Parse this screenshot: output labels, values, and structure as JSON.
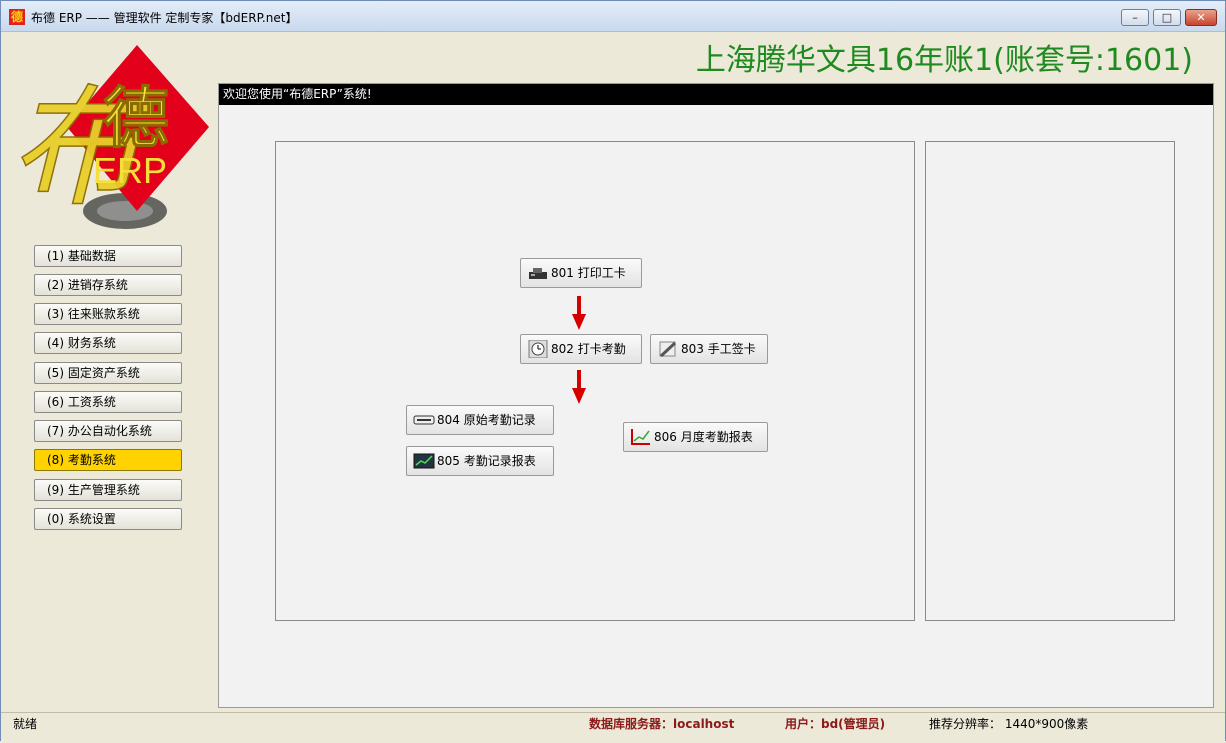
{
  "window": {
    "title": "布德 ERP —— 管理软件 定制专家【bdERP.net】",
    "app_icon_text": "德",
    "controls": {
      "minimize": "–",
      "maximize": "□",
      "close": "✕"
    }
  },
  "header": {
    "company": "上海腾华文具16年账1(账套号:1601)"
  },
  "logo": {
    "script_char": "布",
    "seal_char": "德",
    "seal_sub": "ERP"
  },
  "sidebar": {
    "items": [
      {
        "label": "(1) 基础数据",
        "active": false
      },
      {
        "label": "(2) 进销存系统",
        "active": false
      },
      {
        "label": "(3) 往来账款系统",
        "active": false
      },
      {
        "label": "(4) 财务系统",
        "active": false
      },
      {
        "label": "(5) 固定资产系统",
        "active": false
      },
      {
        "label": "(6) 工资系统",
        "active": false
      },
      {
        "label": "(7) 办公自动化系统",
        "active": false
      },
      {
        "label": "(8) 考勤系统",
        "active": true
      },
      {
        "label": "(9) 生产管理系统",
        "active": false
      },
      {
        "label": "(0) 系统设置",
        "active": false
      }
    ]
  },
  "main": {
    "welcome": "欢迎您使用“布德ERP”系统!",
    "flow": [
      {
        "label": "801 打印工卡",
        "icon": "printer-icon"
      },
      {
        "label": "802 打卡考勤",
        "icon": "clock-icon"
      },
      {
        "label": "803 手工签卡",
        "icon": "pen-icon"
      },
      {
        "label": "804 原始考勤记录",
        "icon": "card-reader-icon"
      },
      {
        "label": "805 考勤记录报表",
        "icon": "chart-board-icon"
      },
      {
        "label": "806 月度考勤报表",
        "icon": "line-chart-icon"
      }
    ]
  },
  "status": {
    "ready": "就绪",
    "db_server": "数据库服务器：localhost",
    "user": "用户：bd(管理员)",
    "resolution": "推荐分辨率： 1440*900像素"
  },
  "colors": {
    "accent_active": "#ffd200",
    "company_text": "#1f8a1f",
    "status_text": "#8b1a1a",
    "arrow": "#d40000"
  }
}
